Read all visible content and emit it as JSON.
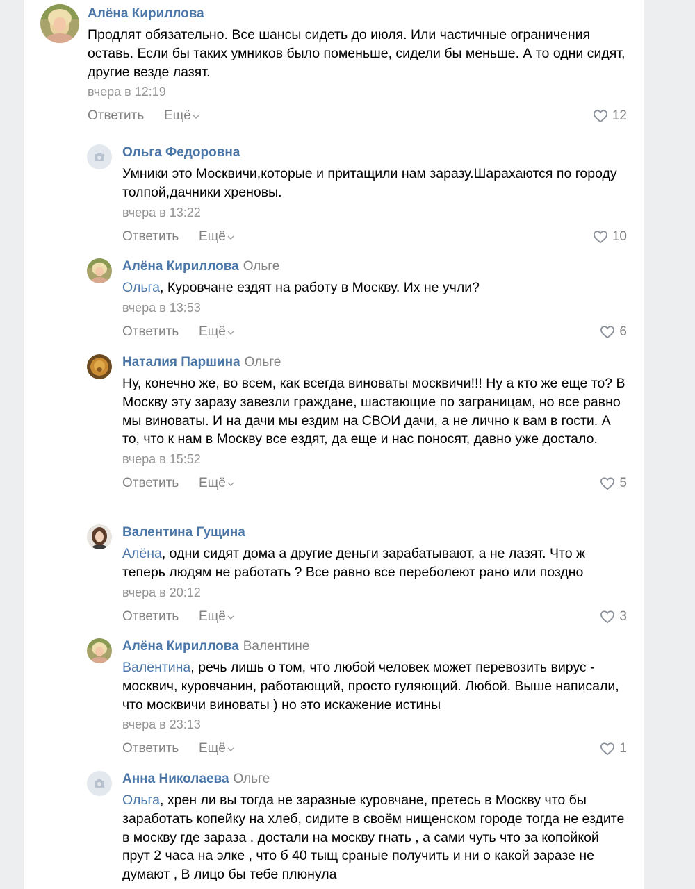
{
  "comments": [
    {
      "author": "Алёна Кириллова",
      "reply_to": "",
      "mention": "",
      "text": "Продлят обязательно. Все шансы сидеть до июля. Или частичные ограничения оставь. Если бы таких умников было поменьше, сидели бы меньше. А то одни сидят, другие везде лазят.",
      "date": "вчера в 12:19",
      "reply_label": "Ответить",
      "more_label": "Ещё",
      "likes": "12"
    },
    {
      "author": "Ольга Федоровна",
      "reply_to": "",
      "mention": "",
      "text": "Умники это Москвичи,которые и притащили нам заразу.Шарахаются по городу толпой,дачники хреновы.",
      "date": "вчера в 13:22",
      "reply_label": "Ответить",
      "more_label": "Ещё",
      "likes": "10"
    },
    {
      "author": "Алёна Кириллова",
      "reply_to": "Ольге",
      "mention": "Ольга",
      "text": ", Куровчане ездят на работу в Москву. Их не учли?",
      "date": "вчера в 13:53",
      "reply_label": "Ответить",
      "more_label": "Ещё",
      "likes": "6"
    },
    {
      "author": "Наталия Паршина",
      "reply_to": "Ольге",
      "mention": "",
      "text": "Ну, конечно же, во всем, как всегда виноваты москвичи!!! Ну а кто же еще то? В Москву эту заразу завезли граждане, шастающие по заграницам, но все равно мы виноваты. И на дачи мы ездим на СВОИ дачи, а не лично к вам в гости. А то, что к нам в Москву все ездят, да еще и нас поносят, давно уже достало.",
      "date": "вчера в 15:52",
      "reply_label": "Ответить",
      "more_label": "Ещё",
      "likes": "5"
    },
    {
      "author": "Валентина Гущина",
      "reply_to": "",
      "mention": "Алёна",
      "text": ", одни сидят дома а другие деньги зарабатывают, а не лазят. Что ж теперь людям не работать ? Все равно все переболеют рано или поздно",
      "date": "вчера в 20:12",
      "reply_label": "Ответить",
      "more_label": "Ещё",
      "likes": "3"
    },
    {
      "author": "Алёна Кириллова",
      "reply_to": "Валентине",
      "mention": "Валентина",
      "text": ", речь лишь о том, что любой человек может перевозить вирус - москвич, куровчанин, работающий, просто гуляющий. Любой. Выше написали, что москвичи виноваты ) но это искажение истины",
      "date": "вчера в 23:13",
      "reply_label": "Ответить",
      "more_label": "Ещё",
      "likes": "1"
    },
    {
      "author": "Анна Николаева",
      "reply_to": "Ольге",
      "mention": "Ольга",
      "text": ", хрен ли вы тогда не заразные куровчане, претесь в Москву что бы заработать копейку на хлеб, сидите в своём нищенском городе тогда не ездите в москву где зараза . достали на москву гнать , а сами чуть что за копойкой прут 2 часа на элке , что б 40 тыщ сраные получить и ни о какой заразе не думают , В лицо бы тебе плюнула",
      "date": "",
      "reply_label": "",
      "more_label": "",
      "likes": ""
    }
  ],
  "icons": {
    "like": "heart-outline-icon",
    "more": "chevron-down-icon",
    "no_photo": "camera-icon"
  },
  "colors": {
    "author": "#4a76a8",
    "secondary": "#828282",
    "date": "#939393",
    "page_bg": "#edeef0"
  }
}
